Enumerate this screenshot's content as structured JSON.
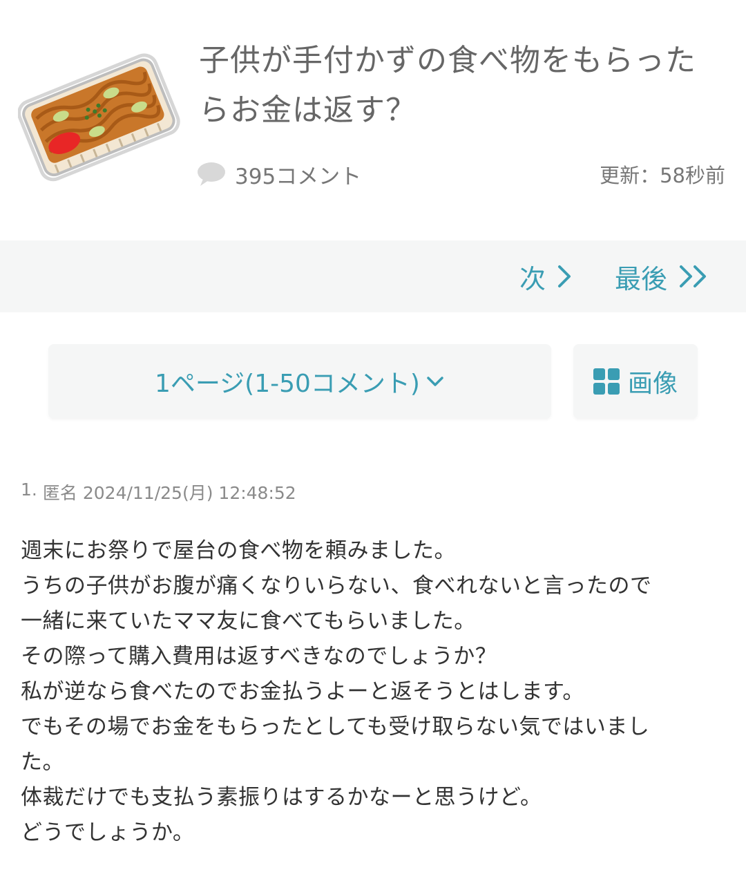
{
  "thread": {
    "title": "子供が手付かずの食べ物をもらったらお金は返す？",
    "title_line1": "子供が手付かずの食べ物をもらった",
    "title_line2": "らお金は返す？",
    "comments_count": "395コメント",
    "updated": "更新：58秒前"
  },
  "icons": {
    "thumbnail": "yakisoba-pack-image",
    "comments": "speech-bubble-icon",
    "next": "chevron-right-icon",
    "last": "double-chevron-right-icon",
    "dropdown": "chevron-down-icon",
    "images": "grid-icon"
  },
  "pager": {
    "next_label": "次",
    "last_label": "最後"
  },
  "page_select": {
    "label": "1ページ(1-50コメント)"
  },
  "images_button": {
    "label": "画像"
  },
  "comment": {
    "number": "1.",
    "author": "匿名",
    "date": "2024/11/25(月) 12:48:52",
    "lines": [
      "週末にお祭りで屋台の食べ物を頼みました。",
      "うちの子供がお腹が痛くなりいらない、食べれないと言ったので",
      "一緒に来ていたママ友に食べてもらいました。",
      "その際って購入費用は返すべきなのでしょうか？",
      "私が逆なら食べたのでお金払うよーと返そうとはします。",
      "でもその場でお金をもらったとしても受け取らない気ではいまし",
      "た。",
      "体裁だけでも支払う素振りはするかなーと思うけど。",
      "どうでしょうか。"
    ]
  },
  "colors": {
    "accent": "#3a9db3",
    "muted_text": "#777777",
    "bar_background": "#f5f6f6"
  }
}
